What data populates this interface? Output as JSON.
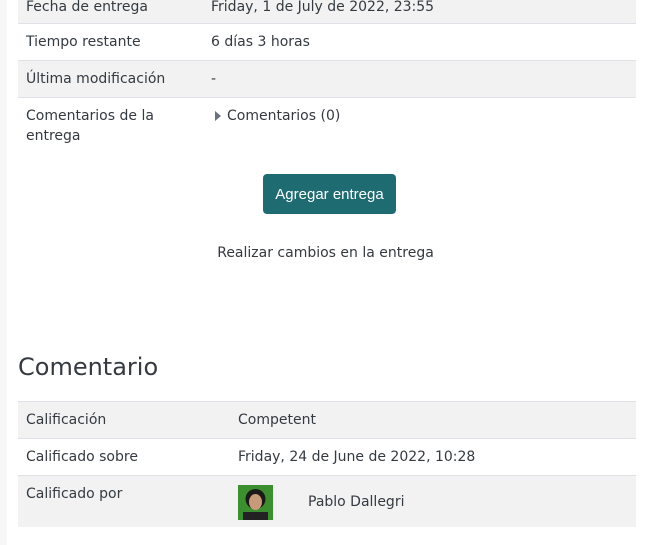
{
  "submission": {
    "due_date": {
      "label": "Fecha de entrega",
      "value": "Friday, 1 de July de 2022, 23:55"
    },
    "time_remaining": {
      "label": "Tiempo restante",
      "value": "6 días 3 horas"
    },
    "last_modified": {
      "label": "Última modificación",
      "value": "-"
    },
    "submission_comments": {
      "label_line1": "Comentarios de la",
      "label_line2": "entrega",
      "value": "Comentarios (0)"
    },
    "add_submission_label": "Agregar entrega",
    "make_changes_text": "Realizar cambios en la entrega"
  },
  "feedback": {
    "heading": "Comentario",
    "grade": {
      "label": "Calificación",
      "value": "Competent"
    },
    "graded_on": {
      "label": "Calificado sobre",
      "value": "Friday, 24 de June de 2022, 10:28"
    },
    "graded_by": {
      "label": "Calificado por",
      "value": "Pablo Dallegri"
    }
  },
  "colors": {
    "button_bg": "#1e6b72",
    "row_alt_bg": "#f2f2f2",
    "border": "#dee2e6"
  },
  "icons": {
    "collapse": "triangle-right-icon"
  }
}
